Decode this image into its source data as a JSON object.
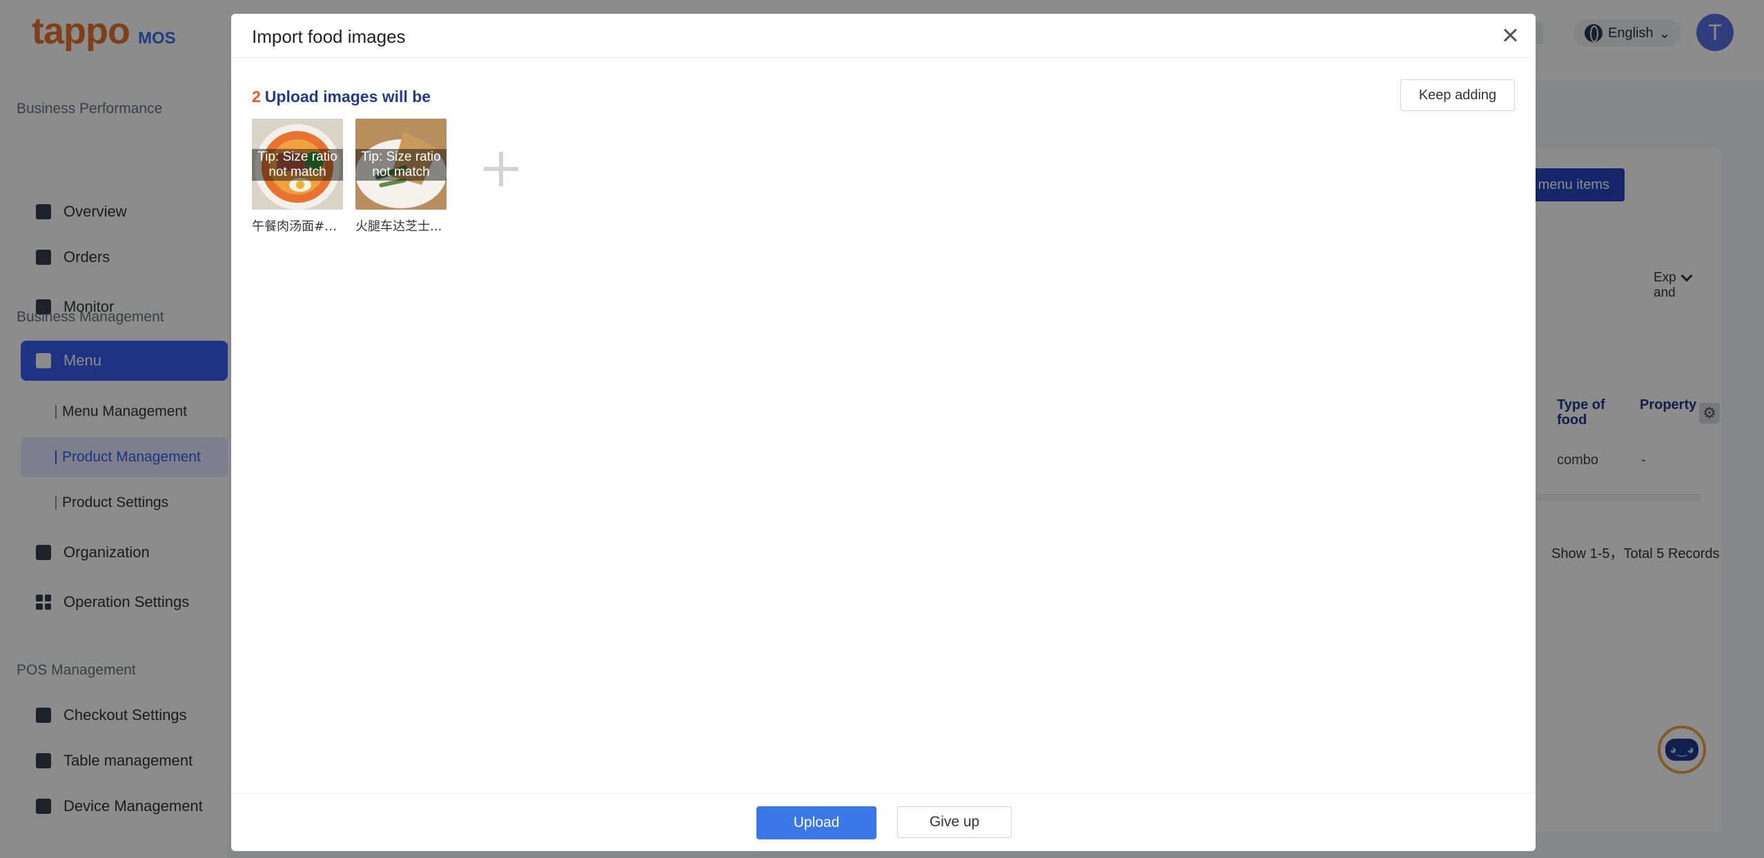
{
  "app": {
    "logo": "tappo",
    "logo_sub": "MOS",
    "language": "English",
    "avatar_initial": "T"
  },
  "sidebar": {
    "groups": [
      {
        "title": "Business Performance"
      },
      {
        "title": "Business Management"
      },
      {
        "title": "POS Management"
      }
    ],
    "items": [
      {
        "label": "Overview",
        "icon": "overview-icon"
      },
      {
        "label": "Orders",
        "icon": "orders-icon"
      },
      {
        "label": "Monitor",
        "icon": "monitor-icon"
      },
      {
        "label": "Menu",
        "icon": "menu-icon",
        "active": true
      },
      {
        "label": "Menu Management",
        "sub": true
      },
      {
        "label": "Product Management",
        "sub": true,
        "active": true
      },
      {
        "label": "Product Settings",
        "sub": true
      },
      {
        "label": "Organization",
        "icon": "organization-icon"
      },
      {
        "label": "Operation Settings",
        "icon": "grid-icon"
      },
      {
        "label": "Checkout Settings",
        "icon": "checkout-icon"
      },
      {
        "label": "Table management",
        "icon": "table-icon"
      },
      {
        "label": "Device Management",
        "icon": "device-icon"
      }
    ]
  },
  "background": {
    "partial_button": "ze menu items",
    "expand": "Exp and",
    "columns": [
      "Type of food",
      "Property"
    ],
    "row": [
      "combo",
      "-"
    ],
    "pager": "Show 1-5，Total 5 Records"
  },
  "modal": {
    "title": "Import food images",
    "upload_count": "2",
    "upload_heading": "Upload images will be",
    "keep_adding": "Keep adding",
    "images": [
      {
        "name": "午餐肉汤面#0....",
        "tip": "Tip: Size ratio not match"
      },
      {
        "name": "火腿车达芝士...",
        "tip": "Tip: Size ratio not match"
      }
    ],
    "upload_label": "Upload",
    "give_up_label": "Give up"
  },
  "colors": {
    "accent": "#3a5bf0",
    "primary_button": "#3b78e7",
    "count": "#f0522d",
    "heading": "#223a8f"
  }
}
